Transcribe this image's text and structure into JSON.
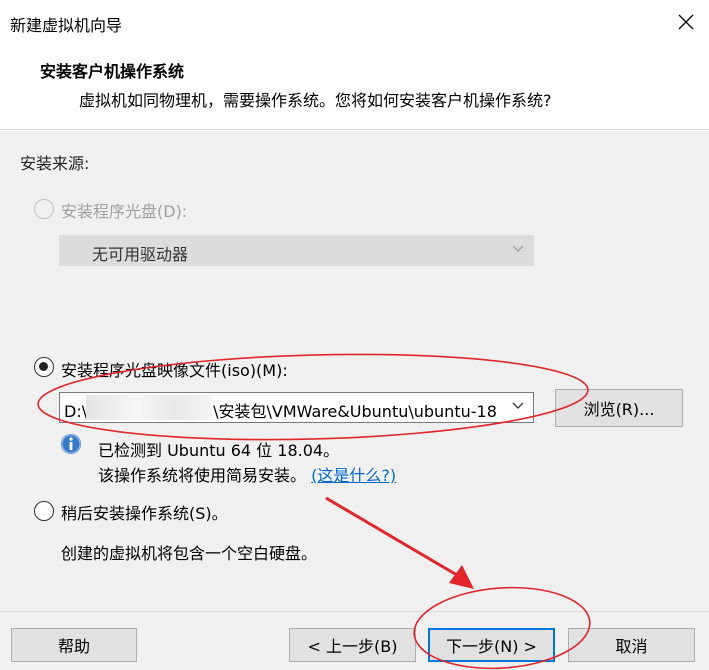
{
  "window": {
    "title": "新建虚拟机向导",
    "close_glyph": "✕"
  },
  "header": {
    "title": "安装客户机操作系统",
    "description": "虚拟机如同物理机，需要操作系统。您将如何安装客户机操作系统?"
  },
  "install_source": {
    "label": "安装来源:",
    "disc_option": {
      "label": "安装程序光盘(D):",
      "selected": false,
      "enabled": false
    },
    "disc_drive_select": {
      "value": "无可用驱动器",
      "enabled": false
    },
    "iso_option": {
      "label": "安装程序光盘映像文件(iso)(M):",
      "selected": true
    },
    "iso_path": {
      "prefix": "D:\\",
      "suffix": "\\安装包\\VMWare&Ubuntu\\ubuntu-18"
    },
    "browse_button": "浏览(R)...",
    "detect_line": "已检测到 Ubuntu 64 位 18.04。",
    "easy_install_line": "该操作系统将使用简易安装。",
    "what_is_this_link": "(这是什么?)",
    "later_option": {
      "label": "稍后安装操作系统(S)。",
      "selected": false
    },
    "later_desc": "创建的虚拟机将包含一个空白硬盘。"
  },
  "footer": {
    "help_button": "帮助",
    "back_button": "< 上一步(B)",
    "next_button": "下一步(N) >",
    "cancel_button": "取消"
  },
  "annotation_color": "#e0262b",
  "accent_color": "#0078d7"
}
